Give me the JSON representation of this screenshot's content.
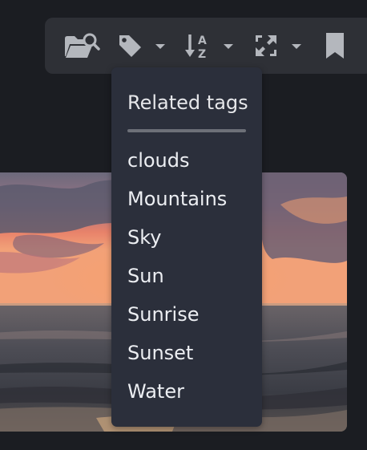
{
  "toolbar": {
    "buttons": [
      {
        "icon": "folder-search-icon"
      },
      {
        "icon": "tag-icon",
        "has_dropdown": true
      },
      {
        "icon": "sort-alpha-down-icon",
        "has_dropdown": true
      },
      {
        "icon": "expand-icon",
        "has_dropdown": true
      },
      {
        "icon": "bookmark-icon"
      }
    ]
  },
  "dropdown": {
    "header": "Related tags",
    "items": [
      "clouds",
      "Mountains",
      "Sky",
      "Sun",
      "Sunrise",
      "Sunset",
      "Water"
    ]
  },
  "colors": {
    "page_background": "#1b1d22",
    "toolbar_background": "#2e3036",
    "dropdown_background": "#2b2f3b",
    "icon_color": "#b4b7bd",
    "text_color": "#eceef2",
    "divider_color": "#6d7078"
  }
}
